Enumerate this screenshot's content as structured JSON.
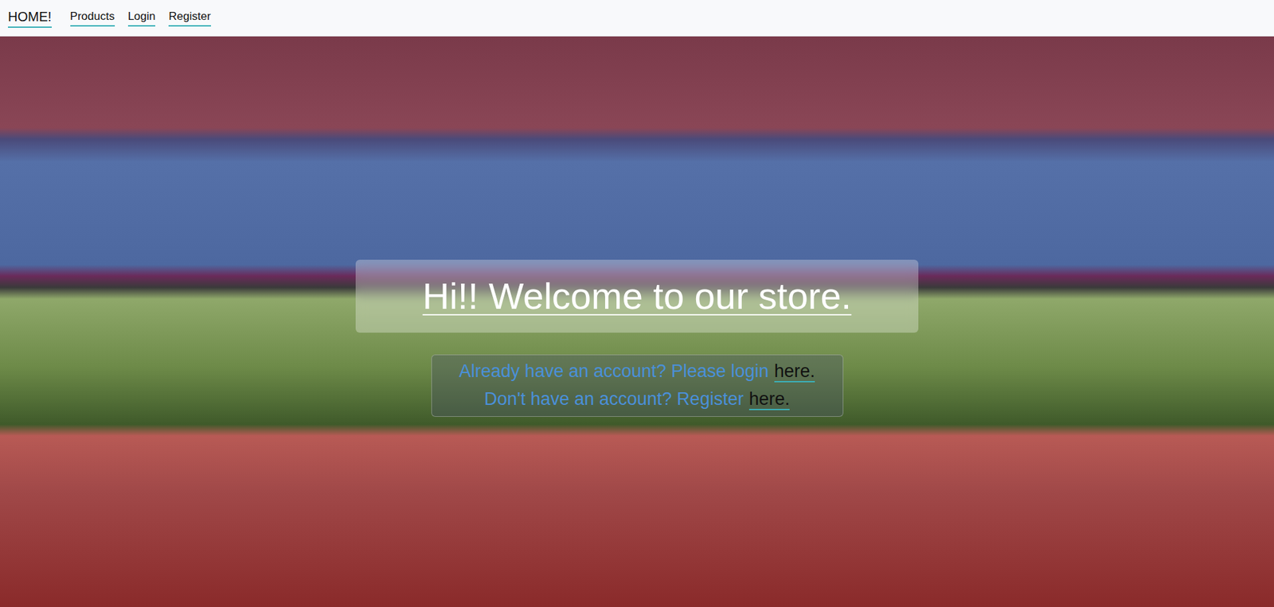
{
  "nav": {
    "brand": "HOME!",
    "links": [
      {
        "label": "Products"
      },
      {
        "label": "Login"
      },
      {
        "label": "Register"
      }
    ]
  },
  "hero": {
    "title": "Hi!! Welcome to our store.",
    "lines": [
      {
        "text": "Already have an account? Please login",
        "link": "here."
      },
      {
        "text": "Don't have an account? Register",
        "link": "here."
      }
    ]
  }
}
